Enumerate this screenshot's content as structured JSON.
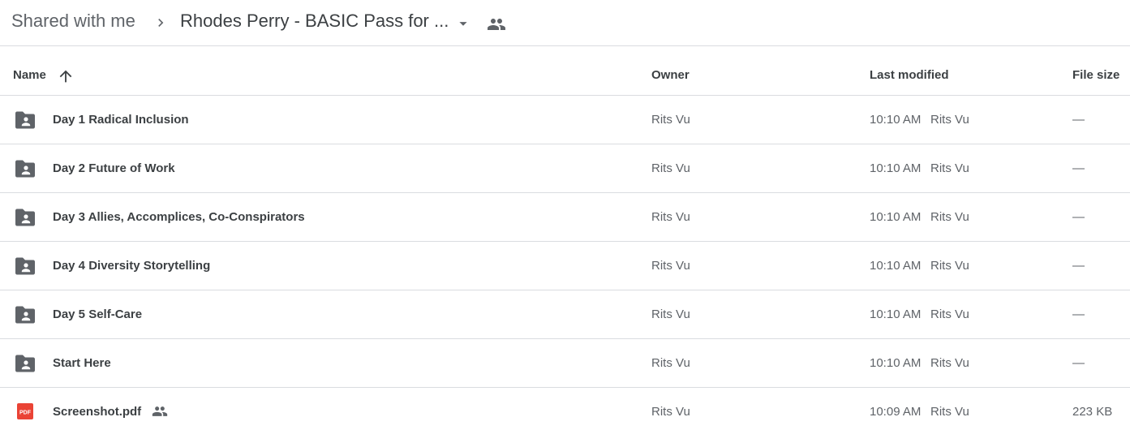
{
  "breadcrumb": {
    "root": "Shared with me",
    "current": "Rhodes Perry - BASIC Pass for ..."
  },
  "columns": {
    "name": "Name",
    "owner": "Owner",
    "last_modified": "Last modified",
    "file_size": "File size"
  },
  "sort": {
    "column": "name",
    "direction": "ascending",
    "icon": "arrow-up-icon"
  },
  "files": [
    {
      "name": "Day 1 Radical Inclusion",
      "type": "shared-folder",
      "icon": "shared-folder-icon",
      "owner": "Rits Vu",
      "modified_time": "10:10 AM",
      "modified_by": "Rits Vu",
      "size": "—"
    },
    {
      "name": "Day 2 Future of Work",
      "type": "shared-folder",
      "icon": "shared-folder-icon",
      "owner": "Rits Vu",
      "modified_time": "10:10 AM",
      "modified_by": "Rits Vu",
      "size": "—"
    },
    {
      "name": "Day 3 Allies, Accomplices, Co-Conspirators",
      "type": "shared-folder",
      "icon": "shared-folder-icon",
      "owner": "Rits Vu",
      "modified_time": "10:10 AM",
      "modified_by": "Rits Vu",
      "size": "—"
    },
    {
      "name": "Day 4 Diversity Storytelling",
      "type": "shared-folder",
      "icon": "shared-folder-icon",
      "owner": "Rits Vu",
      "modified_time": "10:10 AM",
      "modified_by": "Rits Vu",
      "size": "—"
    },
    {
      "name": "Day 5 Self-Care",
      "type": "shared-folder",
      "icon": "shared-folder-icon",
      "owner": "Rits Vu",
      "modified_time": "10:10 AM",
      "modified_by": "Rits Vu",
      "size": "—"
    },
    {
      "name": "Start Here",
      "type": "shared-folder",
      "icon": "shared-folder-icon",
      "owner": "Rits Vu",
      "modified_time": "10:10 AM",
      "modified_by": "Rits Vu",
      "size": "—"
    },
    {
      "name": "Screenshot.pdf",
      "type": "pdf",
      "icon": "pdf-icon",
      "shared": true,
      "owner": "Rits Vu",
      "modified_time": "10:09 AM",
      "modified_by": "Rits Vu",
      "size": "223 KB"
    }
  ],
  "colors": {
    "text_primary": "#3c4043",
    "text_secondary": "#5f6368",
    "divider": "#dadce0",
    "pdf_red": "#ea4335"
  }
}
